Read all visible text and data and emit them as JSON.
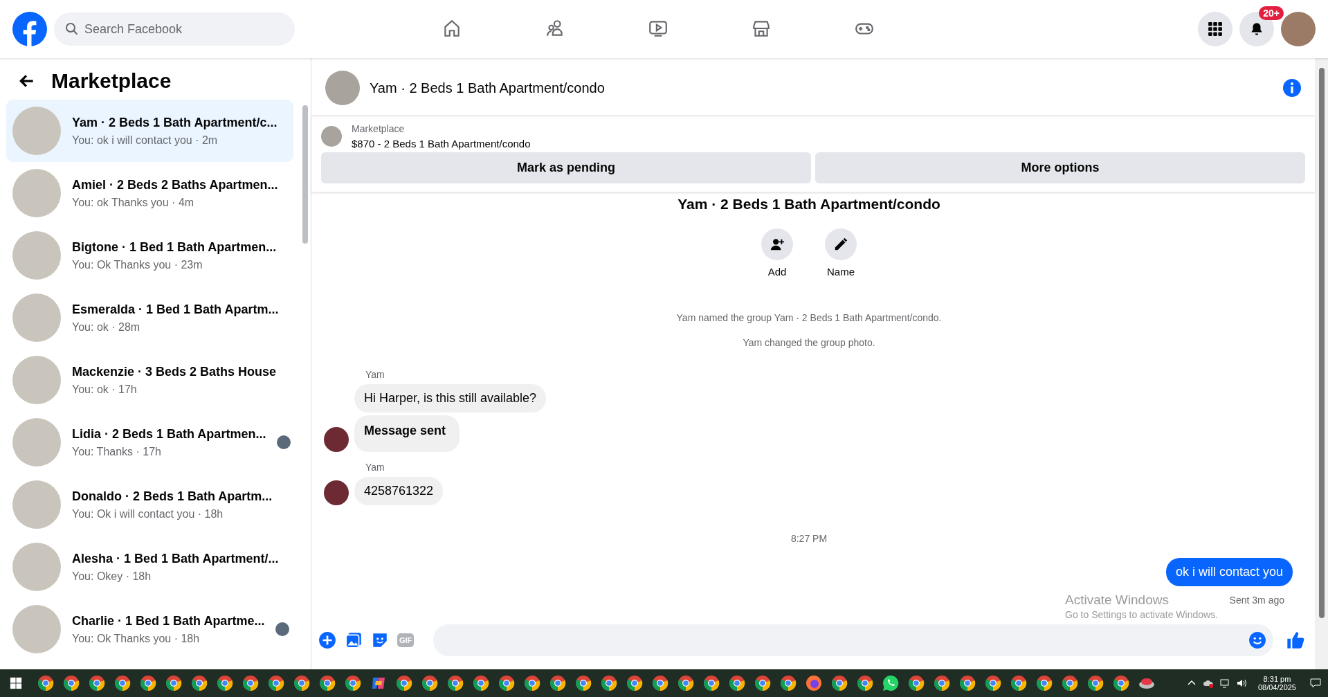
{
  "topbar": {
    "search": {
      "placeholder": "Search Facebook"
    },
    "nav": [
      {
        "kind": "home",
        "selected": false
      },
      {
        "kind": "friends",
        "selected": false
      },
      {
        "kind": "video",
        "selected": false
      },
      {
        "kind": "marketplace",
        "selected": false
      },
      {
        "kind": "gaming",
        "selected": false
      }
    ],
    "notification_badge": "20+"
  },
  "sidebar": {
    "title": "Marketplace",
    "items": [
      {
        "title": "Yam · 2 Beds 1 Bath Apartment/c...",
        "preview": "You: ok i will contact you · 2m",
        "selected": true,
        "seen_avatar": false
      },
      {
        "title": "Amiel · 2 Beds 2 Baths Apartmen...",
        "preview": "You: ok Thanks you · 4m",
        "selected": false,
        "seen_avatar": false
      },
      {
        "title": "Bigtone · 1 Bed 1 Bath Apartmen...",
        "preview": "You: Ok Thanks you · 23m",
        "selected": false,
        "seen_avatar": false
      },
      {
        "title": "Esmeralda · 1 Bed 1 Bath Apartm...",
        "preview": "You: ok · 28m",
        "selected": false,
        "seen_avatar": false
      },
      {
        "title": "Mackenzie · 3 Beds 2 Baths House",
        "preview": "You: ok · 17h",
        "selected": false,
        "seen_avatar": false
      },
      {
        "title": "Lidia · 2 Beds 1 Bath Apartmen...",
        "preview": "You: Thanks · 17h",
        "selected": false,
        "seen_avatar": true
      },
      {
        "title": "Donaldo · 2 Beds 1 Bath Apartm...",
        "preview": "You: Ok i will contact you · 18h",
        "selected": false,
        "seen_avatar": false
      },
      {
        "title": "Alesha · 1 Bed 1 Bath Apartment/...",
        "preview": "You: Okey · 18h",
        "selected": false,
        "seen_avatar": false
      },
      {
        "title": "Charlie · 1 Bed 1 Bath Apartme...",
        "preview": "You: Ok Thanks you · 18h",
        "selected": false,
        "seen_avatar": true
      }
    ]
  },
  "chat": {
    "title": "Yam · 2 Beds 1 Bath Apartment/condo",
    "listing": {
      "source": "Marketplace",
      "summary": "$870 - 2 Beds 1 Bath Apartment/condo"
    },
    "buttons": [
      "Mark as pending",
      "More options"
    ],
    "group_title": "Yam · 2 Beds 1 Bath Apartment/condo",
    "group_actions": [
      {
        "kind": "add-person",
        "label": "Add"
      },
      {
        "kind": "pencil",
        "label": "Name"
      }
    ],
    "messages": [
      {
        "kind": "system",
        "text": "Yam named the group Yam · 2 Beds 1 Bath Apartment/condo."
      },
      {
        "kind": "system",
        "text": "Yam changed the group photo."
      },
      {
        "kind": "sender",
        "text": "Yam"
      },
      {
        "kind": "incoming",
        "text": "Hi Harper, is this still available?",
        "bold": false,
        "avatar": false
      },
      {
        "kind": "incoming",
        "text": "Message sent",
        "bold": true,
        "avatar": true
      },
      {
        "kind": "sender",
        "text": "Yam"
      },
      {
        "kind": "incoming",
        "text": "4258761322",
        "bold": false,
        "avatar": true
      },
      {
        "kind": "time",
        "text": "8:27 PM"
      },
      {
        "kind": "outgoing",
        "text": "ok i will contact you"
      },
      {
        "kind": "receipt",
        "text": "Sent 3m ago"
      }
    ],
    "composer": {
      "gif_label": "GIF"
    }
  },
  "activation_notice": {
    "title": "Activate Windows",
    "hint": "Go to Settings to activate Windows."
  },
  "taskbar": {
    "apps": [
      {
        "kind": "chrome"
      },
      {
        "kind": "chrome"
      },
      {
        "kind": "chrome"
      },
      {
        "kind": "chrome"
      },
      {
        "kind": "chrome"
      },
      {
        "kind": "chrome"
      },
      {
        "kind": "chrome"
      },
      {
        "kind": "chrome"
      },
      {
        "kind": "chrome"
      },
      {
        "kind": "chrome"
      },
      {
        "kind": "chrome"
      },
      {
        "kind": "chrome"
      },
      {
        "kind": "chrome"
      },
      {
        "kind": "copilot"
      },
      {
        "kind": "chrome"
      },
      {
        "kind": "chrome"
      },
      {
        "kind": "chrome"
      },
      {
        "kind": "chrome"
      },
      {
        "kind": "chrome"
      },
      {
        "kind": "chrome"
      },
      {
        "kind": "chrome"
      },
      {
        "kind": "chrome"
      },
      {
        "kind": "chrome"
      },
      {
        "kind": "chrome"
      },
      {
        "kind": "chrome"
      },
      {
        "kind": "chrome"
      },
      {
        "kind": "chrome"
      },
      {
        "kind": "chrome"
      },
      {
        "kind": "chrome"
      },
      {
        "kind": "chrome"
      },
      {
        "kind": "firefox"
      },
      {
        "kind": "chrome"
      },
      {
        "kind": "chrome"
      },
      {
        "kind": "whatsapp"
      },
      {
        "kind": "chrome"
      },
      {
        "kind": "chrome"
      },
      {
        "kind": "chrome"
      },
      {
        "kind": "chrome"
      },
      {
        "kind": "chrome"
      },
      {
        "kind": "chrome"
      },
      {
        "kind": "chrome"
      },
      {
        "kind": "chrome"
      },
      {
        "kind": "chrome"
      },
      {
        "kind": "drive"
      }
    ],
    "time": "8:31 pm",
    "date": "08/04/2025"
  }
}
